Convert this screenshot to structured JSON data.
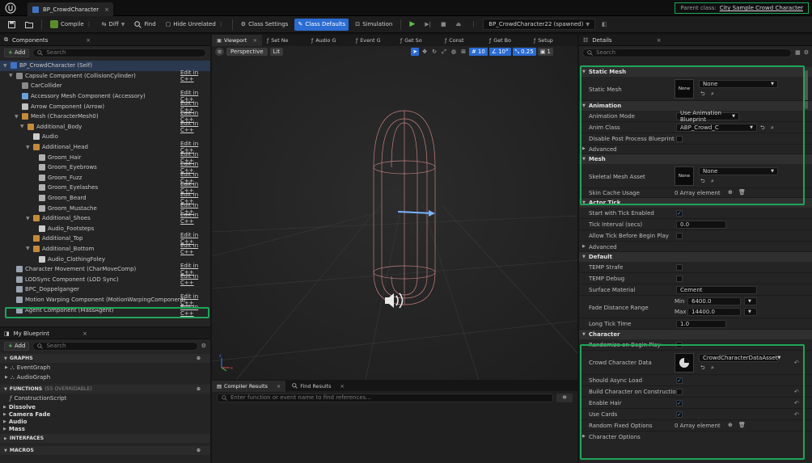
{
  "titlebar": {
    "doc_tab": "BP_CrowdCharacter",
    "parent_label": "Parent class:",
    "parent_value": "City Sample Crowd Character"
  },
  "toolbar": {
    "compile": "Compile",
    "diff": "Diff",
    "find": "Find",
    "hide_unrelated": "Hide Unrelated",
    "class_settings": "Class Settings",
    "class_defaults": "Class Defaults",
    "simulation": "Simulation",
    "debug_object": "BP_CrowdCharacter22 (spawned)"
  },
  "components": {
    "title": "Components",
    "add_label": "Add",
    "search_placeholder": "Search",
    "edit_label": "Edit in C++",
    "items": [
      {
        "label": "BP_CrowdCharacter (Self)"
      },
      {
        "label": "Capsule Component (CollisionCylinder)",
        "edit": true
      },
      {
        "label": "CarCollider"
      },
      {
        "label": "Accessory Mesh Component (Accessory)",
        "edit": true
      },
      {
        "label": "Arrow Component (Arrow)",
        "edit": true
      },
      {
        "label": "Mesh (CharacterMesh0)",
        "edit": true
      },
      {
        "label": "Additional_Body",
        "edit": true
      },
      {
        "label": "Audio"
      },
      {
        "label": "Additional_Head",
        "edit": true
      },
      {
        "label": "Groom_Hair",
        "edit": true
      },
      {
        "label": "Groom_Eyebrows",
        "edit": true
      },
      {
        "label": "Groom_Fuzz",
        "edit": true
      },
      {
        "label": "Groom_Eyelashes",
        "edit": true
      },
      {
        "label": "Groom_Beard",
        "edit": true
      },
      {
        "label": "Groom_Mustache",
        "edit": true
      },
      {
        "label": "Additional_Shoes",
        "edit": true
      },
      {
        "label": "Audio_Footsteps"
      },
      {
        "label": "Additional_Top",
        "edit": true
      },
      {
        "label": "Additional_Bottom",
        "edit": true
      },
      {
        "label": "Audio_ClothingFoley"
      },
      {
        "label": "Character Movement (CharMoveComp)",
        "edit": true
      },
      {
        "label": "LODSync Component (LOD Sync)",
        "edit": true
      },
      {
        "label": "BPC_Doppelganger"
      },
      {
        "label": "Motion Warping Component (MotionWarpingComponent)",
        "edit": true
      },
      {
        "label": "Agent Component (MassAgent)",
        "edit": true
      }
    ]
  },
  "blueprint": {
    "title": "My Blueprint",
    "add_label": "Add",
    "search_placeholder": "Search",
    "graphs_label": "GRAPHS",
    "graphs": [
      "EventGraph",
      "AudioGraph"
    ],
    "functions_label": "FUNCTIONS",
    "functions_note": "(55 OVERRIDABLE)",
    "functions": [
      "ConstructionScript"
    ],
    "categories": [
      "Dissolve",
      "Camera Fade",
      "Audio",
      "Mass"
    ],
    "interfaces_label": "INTERFACES",
    "macros_label": "MACROS"
  },
  "viewport": {
    "tabs": [
      "Viewport",
      "Set Ne",
      "Audio G",
      "Event G",
      "Get So",
      "Const",
      "Get Bo",
      "Setup"
    ],
    "perspective": "Perspective",
    "lit": "Lit",
    "snap_grid": "10",
    "snap_rot": "10°",
    "snap_scale": "0.25",
    "cam_speed": "1"
  },
  "bottom": {
    "tab_compiler": "Compiler Results",
    "tab_find": "Find Results",
    "search_placeholder": "Enter function or event name to find references..."
  },
  "details": {
    "title": "Details",
    "search_placeholder": "Search",
    "static_mesh": {
      "header": "Static Mesh",
      "label": "Static Mesh",
      "thumb": "None",
      "value": "None"
    },
    "animation": {
      "header": "Animation",
      "mode_label": "Animation Mode",
      "mode_value": "Use Animation Blueprint",
      "class_label": "Anim Class",
      "class_value": "ABP_Crowd_C",
      "disable_pp_label": "Disable Post Process Blueprint",
      "advanced": "Advanced"
    },
    "mesh": {
      "header": "Mesh",
      "asset_label": "Skeletal Mesh Asset",
      "thumb": "None",
      "value": "None",
      "skin_cache_label": "Skin Cache Usage",
      "skin_cache_value": "0 Array element"
    },
    "actor_tick": {
      "header": "Actor Tick",
      "start_label": "Start with Tick Enabled",
      "interval_label": "Tick Interval (secs)",
      "interval_value": "0.0",
      "allow_label": "Allow Tick Before Begin Play",
      "advanced": "Advanced"
    },
    "default": {
      "header": "Default",
      "temp_strafe": "TEMP Strafe",
      "temp_debug": "TEMP Debug",
      "surface_label": "Surface Material",
      "surface_value": "Cement",
      "fade_label": "Fade Distance Range",
      "min_label": "Min",
      "min_value": "6400.0",
      "max_label": "Max",
      "max_value": "14400.0",
      "long_tick_label": "Long Tick Time",
      "long_tick_value": "1.0"
    },
    "character": {
      "header": "Character",
      "randomize_label": "Randomize on Begin Play",
      "crowd_data_label": "Crowd Character Data",
      "crowd_data_value": "CrowdCharacterDataAsset",
      "async_label": "Should Async Load",
      "build_label": "Build Character on Construction",
      "hair_label": "Enable Hair",
      "cards_label": "Use Cards",
      "random_fixed_label": "Random Fixed Options",
      "random_fixed_value": "0 Array element",
      "options": "Character Options"
    }
  },
  "colors": {
    "accent_blue": "#2b6cd2",
    "highlight_green": "#1ea55a",
    "panel_bg": "#242424"
  }
}
